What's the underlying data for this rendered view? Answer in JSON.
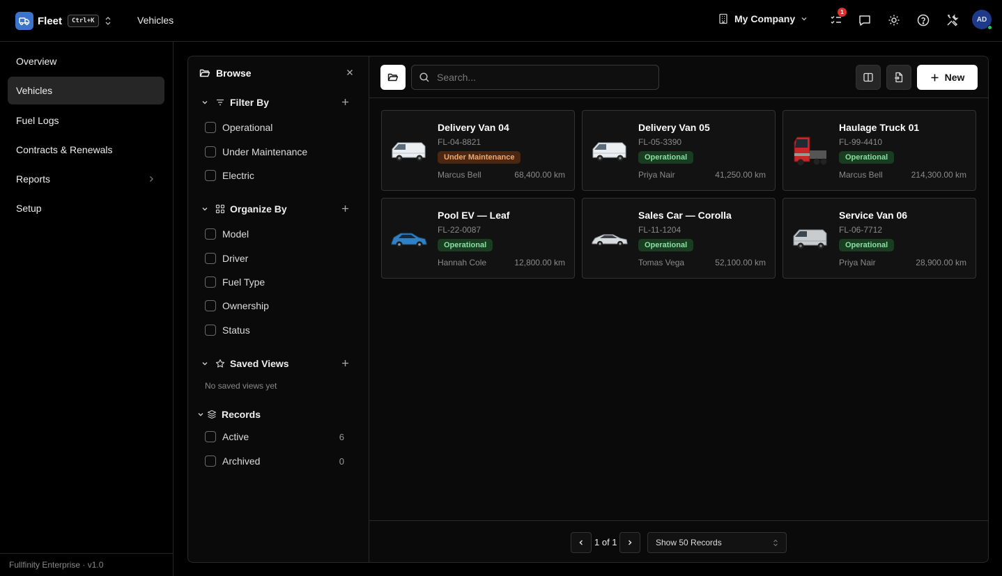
{
  "app": {
    "brand": "Fleet",
    "shortcut": "Ctrl+K",
    "page_title": "Vehicles",
    "company": "My Company",
    "notification_count": "1",
    "avatar_initials": "AD"
  },
  "sidebar": {
    "items": [
      {
        "label": "Overview"
      },
      {
        "label": "Vehicles"
      },
      {
        "label": "Fuel Logs"
      },
      {
        "label": "Contracts & Renewals"
      },
      {
        "label": "Reports"
      },
      {
        "label": "Setup"
      }
    ],
    "footer": "Fullfinity Enterprise · v1.0"
  },
  "browse": {
    "title": "Browse",
    "filter_by": {
      "label": "Filter By",
      "options": [
        "Operational",
        "Under Maintenance",
        "Electric"
      ]
    },
    "organize_by": {
      "label": "Organize By",
      "options": [
        "Model",
        "Driver",
        "Fuel Type",
        "Ownership",
        "Status"
      ]
    },
    "saved_views": {
      "label": "Saved Views",
      "empty": "No saved views yet"
    },
    "records": {
      "label": "Records",
      "options": [
        {
          "label": "Active",
          "count": "6"
        },
        {
          "label": "Archived",
          "count": "0"
        }
      ]
    }
  },
  "toolbar": {
    "search_placeholder": "Search...",
    "new_label": "New"
  },
  "vehicles": [
    {
      "name": "Delivery Van 04",
      "code": "FL-04-8821",
      "status": "Under Maintenance",
      "driver": "Marcus Bell",
      "odometer": "68,400.00 km",
      "image": "white-van-icon"
    },
    {
      "name": "Delivery Van 05",
      "code": "FL-05-3390",
      "status": "Operational",
      "driver": "Priya Nair",
      "odometer": "41,250.00 km",
      "image": "white-van-icon"
    },
    {
      "name": "Haulage Truck 01",
      "code": "FL-99-4410",
      "status": "Operational",
      "driver": "Marcus Bell",
      "odometer": "214,300.00 km",
      "image": "red-truck-icon"
    },
    {
      "name": "Pool EV — Leaf",
      "code": "FL-22-0087",
      "status": "Operational",
      "driver": "Hannah Cole",
      "odometer": "12,800.00 km",
      "image": "blue-car-icon"
    },
    {
      "name": "Sales Car — Corolla",
      "code": "FL-11-1204",
      "status": "Operational",
      "driver": "Tomas Vega",
      "odometer": "52,100.00 km",
      "image": "silver-car-icon"
    },
    {
      "name": "Service Van 06",
      "code": "FL-06-7712",
      "status": "Operational",
      "driver": "Priya Nair",
      "odometer": "28,900.00 km",
      "image": "grey-van-icon"
    }
  ],
  "pagination": {
    "text": "1 of 1",
    "page_size": "Show 50 Records"
  },
  "colors": {
    "accent": "#3b74c8",
    "operational_bg": "#1a3d22",
    "operational_fg": "#86e0a0",
    "maintenance_bg": "#4a2713",
    "maintenance_fg": "#f5a66a"
  }
}
